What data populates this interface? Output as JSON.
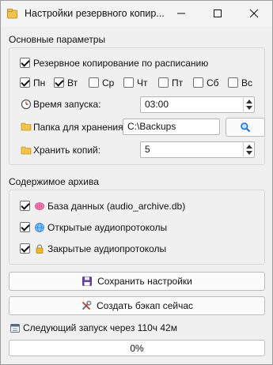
{
  "window": {
    "title": "Настройки резервного копир..."
  },
  "main_params": {
    "title": "Основные параметры",
    "schedule_backup": {
      "label": "Резервное копирование по расписанию",
      "checked": true
    },
    "days": [
      {
        "label": "Пн",
        "checked": true
      },
      {
        "label": "Вт",
        "checked": true
      },
      {
        "label": "Ср",
        "checked": false
      },
      {
        "label": "Чт",
        "checked": false
      },
      {
        "label": "Пт",
        "checked": false
      },
      {
        "label": "Сб",
        "checked": false
      },
      {
        "label": "Вс",
        "checked": false
      }
    ],
    "start_time": {
      "label": "Время запуска:",
      "value": "03:00"
    },
    "storage_folder": {
      "label": "Папка для хранения:",
      "value": "C:\\Backups"
    },
    "keep_copies": {
      "label": "Хранить копий:",
      "value": "5"
    }
  },
  "archive_contents": {
    "title": "Содержимое архива",
    "items": [
      {
        "label": "База данных (audio_archive.db)",
        "checked": true,
        "icon": "brain-icon"
      },
      {
        "label": "Открытые аудиопротоколы",
        "checked": true,
        "icon": "globe-icon"
      },
      {
        "label": "Закрытые аудиопротоколы",
        "checked": true,
        "icon": "lock-icon"
      }
    ]
  },
  "buttons": {
    "save": "Сохранить настройки",
    "backup_now": "Создать бэкап сейчас"
  },
  "status": {
    "next_run": "Следующий запуск через 110ч 42м",
    "progress_text": "0%",
    "progress_value": 0
  },
  "colors": {
    "window_bg": "#f0f0f0",
    "folder_icon": "#f2c14e",
    "progress_fill": "#06b025"
  }
}
